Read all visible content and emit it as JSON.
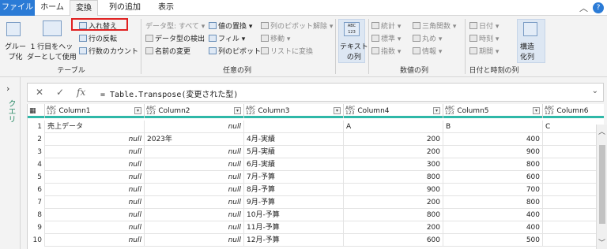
{
  "tabs": [
    "ファイル",
    "ホーム",
    "変換",
    "列の追加",
    "表示"
  ],
  "ribbon": {
    "table_group": {
      "group_label": "テーブル",
      "group_by": "グルー\nプ化",
      "use_first_row": "1 行目をヘッ\nダーとして使用",
      "transpose": "入れ替え",
      "reverse_rows": "行の反転",
      "count_rows": "行数のカウント"
    },
    "any_column_group": {
      "group_label": "任意の列",
      "data_type": "データ型: すべて",
      "detect_type": "データ型の検出",
      "rename": "名前の変更",
      "replace_values": "値の置換",
      "fill": "フィル",
      "pivot": "列のピボット",
      "unpivot": "列のピボット解除",
      "move": "移動",
      "convert_list": "リストに変換"
    },
    "text_group": {
      "label": "テキスト\nの列"
    },
    "number_group": {
      "group_label": "数値の列",
      "statistics": "統計",
      "standard": "標準",
      "scientific": "指数",
      "trig": "三角関数",
      "rounding": "丸め",
      "info": "情報"
    },
    "datetime_group": {
      "group_label": "日付と時刻の列",
      "date": "日付",
      "time": "時刻",
      "duration": "期間",
      "structured": "構造\n化列"
    }
  },
  "sidebar": {
    "label": "クエリ"
  },
  "formula_bar": {
    "formula": "= Table.Transpose(変更された型)"
  },
  "grid": {
    "columns": [
      "Column1",
      "Column2",
      "Column3",
      "Column4",
      "Column5",
      "Column6"
    ],
    "type_label": "ABC\n123",
    "rows": [
      [
        "1",
        "売上データ",
        "null",
        "",
        "A",
        "B",
        "C"
      ],
      [
        "2",
        "null",
        "2023年",
        "4月-実績",
        "200",
        "400",
        ""
      ],
      [
        "3",
        "null",
        "null",
        "5月-実績",
        "200",
        "900",
        ""
      ],
      [
        "4",
        "null",
        "null",
        "6月-実績",
        "300",
        "800",
        ""
      ],
      [
        "5",
        "null",
        "null",
        "7月-予算",
        "800",
        "600",
        ""
      ],
      [
        "6",
        "null",
        "null",
        "8月-予算",
        "900",
        "700",
        ""
      ],
      [
        "7",
        "null",
        "null",
        "9月-予算",
        "200",
        "800",
        ""
      ],
      [
        "8",
        "null",
        "null",
        "10月-予算",
        "800",
        "400",
        ""
      ],
      [
        "9",
        "null",
        "null",
        "11月-予算",
        "200",
        "400",
        ""
      ],
      [
        "10",
        "null",
        "null",
        "12月-予算",
        "600",
        "500",
        ""
      ]
    ]
  },
  "colors": {
    "accent": "#2b7bd6",
    "header_rule": "#2fb8a8",
    "highlight": "#e02020"
  }
}
